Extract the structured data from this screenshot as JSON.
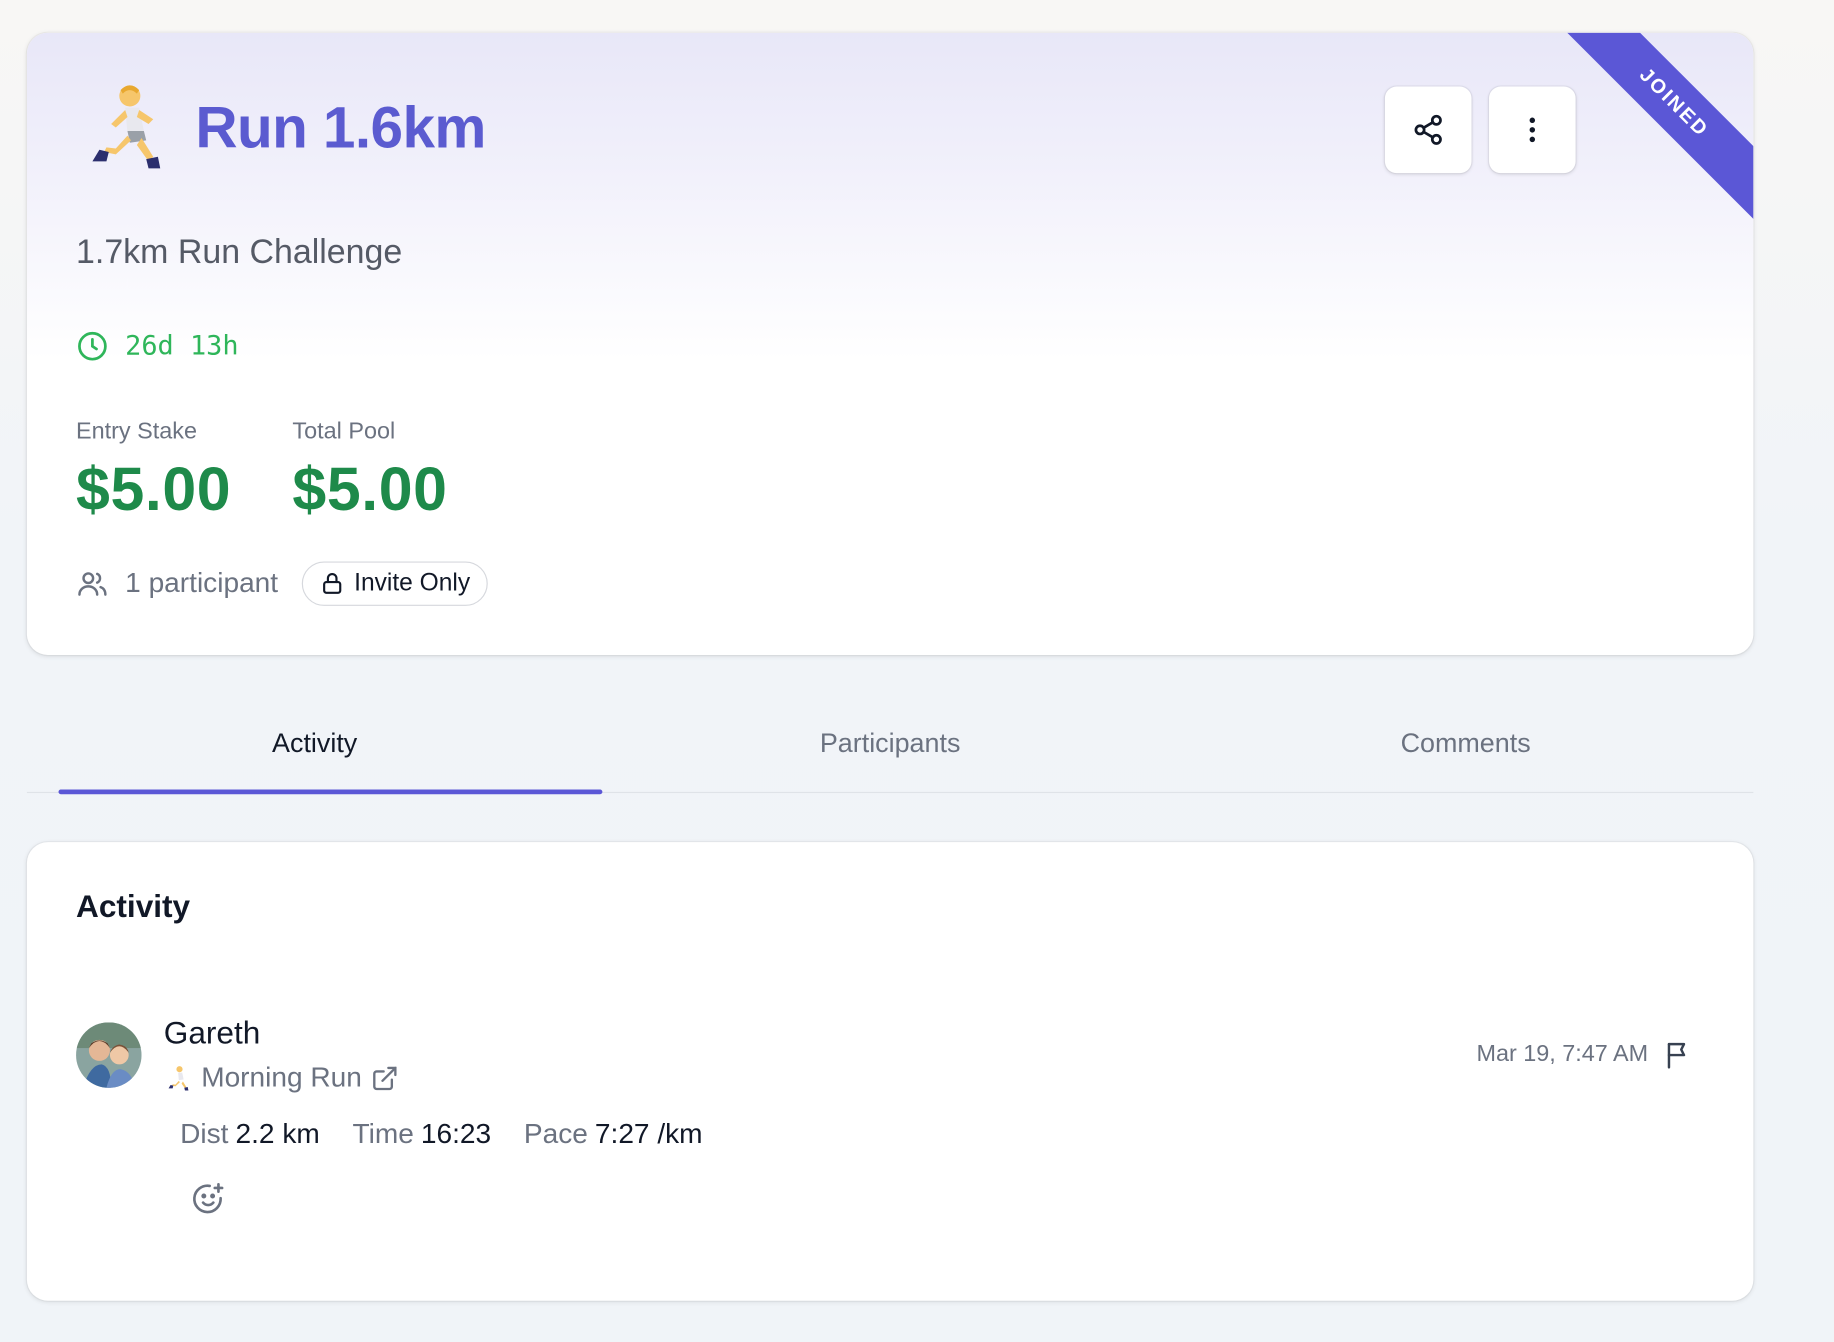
{
  "challenge": {
    "title": "Run 1.6km",
    "subtitle": "1.7km Run Challenge",
    "time_remaining": "26d  13h",
    "ribbon": "JOINED",
    "entry_stake": {
      "label": "Entry Stake",
      "value": "$5.00"
    },
    "total_pool": {
      "label": "Total Pool",
      "value": "$5.00"
    },
    "participants": "1 participant",
    "visibility": "Invite Only",
    "icons": {
      "emoji": "runner-emoji",
      "share": "share-icon",
      "more": "more-vertical-icon",
      "timer": "clock-icon",
      "people": "users-icon",
      "lock": "lock-icon"
    }
  },
  "tabs": [
    {
      "label": "Activity",
      "active": true
    },
    {
      "label": "Participants",
      "active": false
    },
    {
      "label": "Comments",
      "active": false
    }
  ],
  "activity": {
    "heading": "Activity",
    "entries": [
      {
        "user": "Gareth",
        "run_name": "Morning Run",
        "timestamp": "Mar 19, 7:47 AM",
        "stats": [
          {
            "label": "Dist",
            "value": "2.2 km"
          },
          {
            "label": "Time",
            "value": "16:23"
          },
          {
            "label": "Pace",
            "value": "7:27 /km"
          }
        ]
      }
    ]
  },
  "colors": {
    "accent": "#5b57d6",
    "title": "#5b5bd0",
    "money": "#1e8a4a",
    "timer": "#2fb65a"
  }
}
